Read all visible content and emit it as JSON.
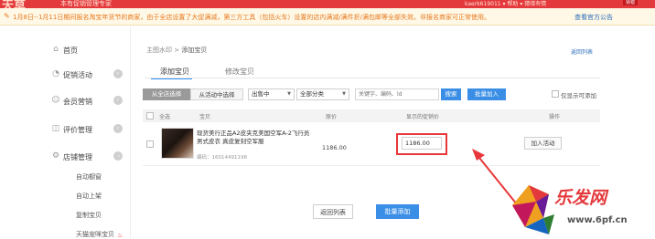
{
  "topbar": {
    "brand": "天草",
    "brand_sub": "本有促销管理专家",
    "user": "kaerk619011 ▾   帮助 ▾   猜错有情",
    "badge": "猜错"
  },
  "notice": {
    "text": "1月8日--1月11日期间报名淘宝年货节的商家，由于全店设置了大促满减，第三方工具（包括火车）设置的店内满减/满件折/满包邮等全部失效。非报名商家可正常使用。",
    "link": "查看官方公告"
  },
  "sidebar": {
    "items": [
      {
        "label": "首页",
        "icon": "home-icon",
        "glyph": "⌂"
      },
      {
        "label": "促销活动",
        "icon": "tag-icon",
        "glyph": "◔"
      },
      {
        "label": "会员营销",
        "icon": "user-icon",
        "glyph": "☺"
      },
      {
        "label": "评价管理",
        "icon": "comment-icon",
        "glyph": "◫"
      },
      {
        "label": "店铺管理",
        "icon": "shop-icon",
        "glyph": "⚙"
      }
    ],
    "chevron": "›",
    "subitems": [
      "自动橱窗",
      "自动上架",
      "复制宝贝",
      "天猫宠咪宝贝"
    ]
  },
  "main": {
    "breadcrumb": {
      "parent": "主图水印",
      "sep": " > ",
      "current": "添加宝贝"
    },
    "back_link": "返回列表",
    "tabs": [
      {
        "label": "添加宝贝",
        "active": true
      },
      {
        "label": "修改宝贝",
        "active": false
      }
    ],
    "filters": {
      "all_shop": "从全店选择",
      "from_activity": "从活动中选择",
      "status_select": "出售中",
      "category_select": "全部分类",
      "keyword_placeholder": "关键字、编码、ld",
      "search": "搜索",
      "batch_add": "批量加入",
      "only_show": "仅显示可添加"
    },
    "table": {
      "headers": [
        "全选",
        "宝贝",
        "原价",
        "显示的促销价",
        "操作"
      ],
      "rows": [
        {
          "name": "现货美行正品A2皮夹克美国空军A-2飞行员男式皮衣 真皮复刻空军服",
          "code": "编码：16014491198",
          "price": "1186.00",
          "promo_price": "1186.00",
          "action": "加入活动"
        }
      ]
    },
    "footer": {
      "back": "返回列表",
      "batch_add": "批量添加"
    }
  },
  "watermark": {
    "text": "乐发网",
    "url": "www.6pf.cn"
  },
  "colors": {
    "brand_red": "#e4393c",
    "accent_blue": "#3a8ee6",
    "notice_orange": "#e6781e"
  }
}
